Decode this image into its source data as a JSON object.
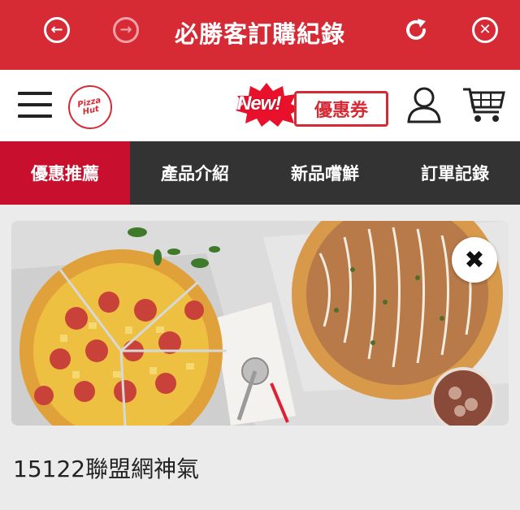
{
  "topbar": {
    "title": "必勝客訂購紀錄",
    "back_icon": "arrow-left-circle-icon",
    "forward_icon": "arrow-right-circle-icon",
    "refresh_icon": "refresh-icon",
    "close_icon": "close-circle-icon",
    "color": "#d62a35"
  },
  "header": {
    "logo_text": "Pizza Hut",
    "promo_new": "New!",
    "promo_label": "優惠券"
  },
  "nav": {
    "tabs": [
      {
        "label": "優惠推薦",
        "active": true
      },
      {
        "label": "產品介紹",
        "active": false
      },
      {
        "label": "新品嚐鮮",
        "active": false
      },
      {
        "label": "訂單記錄",
        "active": false
      }
    ],
    "active_color": "#c8102e",
    "bg_color": "#333333"
  },
  "banner": {
    "close_icon": "close-icon"
  },
  "caption": "15122聯盟網神氣"
}
